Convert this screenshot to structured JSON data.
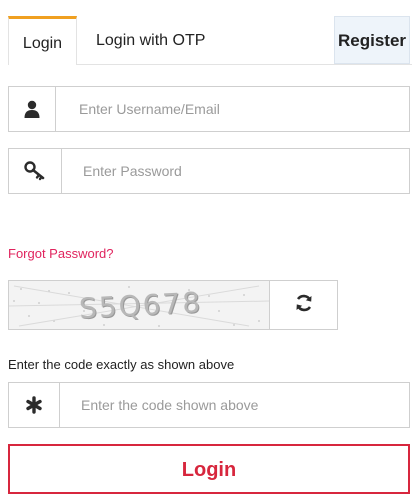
{
  "tabs": {
    "login": "Login",
    "otp": "Login with OTP",
    "register": "Register"
  },
  "fields": {
    "username": {
      "placeholder": "Enter Username/Email",
      "icon": "user-icon"
    },
    "password": {
      "placeholder": "Enter Password",
      "icon": "key-icon"
    },
    "code": {
      "placeholder": "Enter the code shown above",
      "icon": "asterisk-icon"
    }
  },
  "forgot_password": "Forgot Password?",
  "captcha": {
    "text": "S5Q678",
    "refresh_icon": "refresh-icon"
  },
  "code_hint": "Enter the code exactly as shown above",
  "login_button": "Login",
  "colors": {
    "active_tab_accent": "#f0a020",
    "link": "#e0245e",
    "login_button": "#d7263d",
    "register_bg": "#eef4fa"
  }
}
